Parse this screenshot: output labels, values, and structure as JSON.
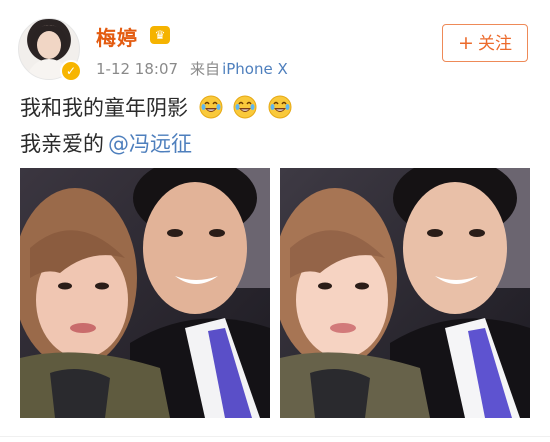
{
  "header": {
    "username": "梅婷",
    "timestamp": "1-12 18:07",
    "source_label": "来自",
    "source_device": "iPhone X",
    "follow_label": "关注",
    "follow_plus": "+"
  },
  "post": {
    "line1_text": "我和我的童年阴影",
    "line1_emoji": [
      "laugh-cry-emoji",
      "laugh-cry-emoji",
      "laugh-cry-emoji"
    ],
    "line2_text": "我亲爱的",
    "mention": "@冯远征"
  },
  "photos": [
    {
      "name": "selfie-photo-1"
    },
    {
      "name": "selfie-photo-2"
    }
  ],
  "colors": {
    "username": "#e35b10",
    "link": "#4e7fbd",
    "follow_border": "#ee8a58",
    "meta": "#8a8a8a"
  }
}
